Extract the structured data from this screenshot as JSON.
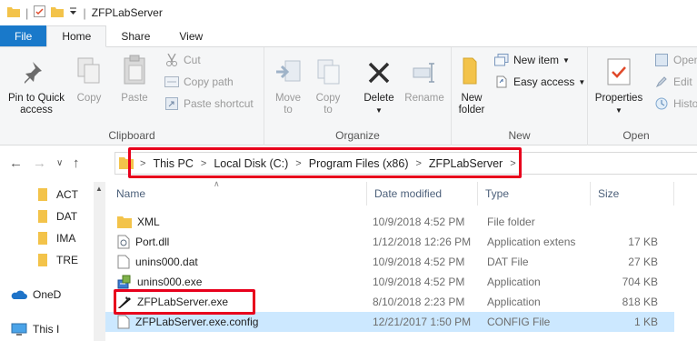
{
  "window": {
    "title": "ZFPLabServer"
  },
  "tabs": [
    {
      "label": "File"
    },
    {
      "label": "Home"
    },
    {
      "label": "Share"
    },
    {
      "label": "View"
    }
  ],
  "ribbon": {
    "clipboard": {
      "group_label": "Clipboard",
      "pin_label_1": "Pin to Quick",
      "pin_label_2": "access",
      "copy_label": "Copy",
      "paste_label": "Paste",
      "cut_label": "Cut",
      "copy_path_label": "Copy path",
      "paste_shortcut_label": "Paste shortcut"
    },
    "organize": {
      "group_label": "Organize",
      "move_to_1": "Move",
      "move_to_2": "to",
      "copy_to_1": "Copy",
      "copy_to_2": "to",
      "delete_label": "Delete",
      "rename_label": "Rename"
    },
    "new": {
      "group_label": "New",
      "new_folder_1": "New",
      "new_folder_2": "folder",
      "new_item_label": "New item",
      "easy_access_label": "Easy access"
    },
    "open": {
      "group_label": "Open",
      "properties_label": "Properties",
      "open_label": "Open",
      "edit_label": "Edit",
      "history_label": "Histo"
    }
  },
  "address": {
    "crumbs": [
      "This PC",
      "Local Disk (C:)",
      "Program Files (x86)",
      "ZFPLabServer"
    ]
  },
  "nav_pane": {
    "items": [
      {
        "label": "ACT",
        "icon": "folder-icon"
      },
      {
        "label": "DAT",
        "icon": "folder-icon"
      },
      {
        "label": "IMA",
        "icon": "folder-icon"
      },
      {
        "label": "TRE",
        "icon": "folder-icon"
      },
      {
        "label": "OneD",
        "icon": "cloud-icon"
      },
      {
        "label": "This I",
        "icon": "computer-icon"
      }
    ]
  },
  "file_list": {
    "columns": {
      "name": "Name",
      "date": "Date modified",
      "type": "Type",
      "size": "Size"
    },
    "rows": [
      {
        "name": "XML",
        "date": "10/9/2018 4:52 PM",
        "type": "File folder",
        "size": "",
        "icon": "folder-icon"
      },
      {
        "name": "Port.dll",
        "date": "1/12/2018 12:26 PM",
        "type": "Application extens",
        "size": "17 KB",
        "icon": "dll-icon"
      },
      {
        "name": "unins000.dat",
        "date": "10/9/2018 4:52 PM",
        "type": "DAT File",
        "size": "27 KB",
        "icon": "file-icon"
      },
      {
        "name": "unins000.exe",
        "date": "10/9/2018 4:52 PM",
        "type": "Application",
        "size": "704 KB",
        "icon": "installer-icon"
      },
      {
        "name": "ZFPLabServer.exe",
        "date": "8/10/2018 2:23 PM",
        "type": "Application",
        "size": "818 KB",
        "icon": "app-icon"
      },
      {
        "name": "ZFPLabServer.exe.config",
        "date": "12/21/2017 1:50 PM",
        "type": "CONFIG File",
        "size": "1 KB",
        "icon": "file-icon"
      }
    ]
  }
}
